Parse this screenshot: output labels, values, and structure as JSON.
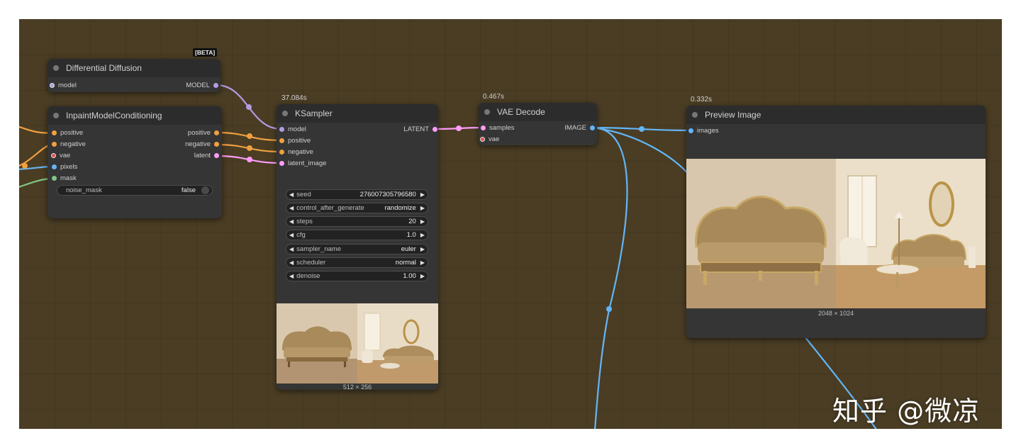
{
  "nodes": {
    "differential_diffusion": {
      "title": "Differential Diffusion",
      "badge": "[BETA]",
      "inputs": [
        "model"
      ],
      "outputs": [
        "MODEL"
      ]
    },
    "inpaint_model_conditioning": {
      "title": "InpaintModelConditioning",
      "inputs": [
        "positive",
        "negative",
        "vae",
        "pixels",
        "mask"
      ],
      "outputs": [
        "positive",
        "negative",
        "latent"
      ],
      "widget": {
        "label": "noise_mask",
        "value": "false"
      }
    },
    "ksampler": {
      "title": "KSampler",
      "exec_time": "37.084s",
      "inputs": [
        "model",
        "positive",
        "negative",
        "latent_image"
      ],
      "outputs": [
        "LATENT"
      ],
      "widgets": [
        {
          "label": "seed",
          "value": "276007305796580"
        },
        {
          "label": "control_after_generate",
          "value": "randomize"
        },
        {
          "label": "steps",
          "value": "20"
        },
        {
          "label": "cfg",
          "value": "1.0"
        },
        {
          "label": "sampler_name",
          "value": "euler"
        },
        {
          "label": "scheduler",
          "value": "normal"
        },
        {
          "label": "denoise",
          "value": "1.00"
        }
      ],
      "preview_size": "512 × 256"
    },
    "vae_decode": {
      "title": "VAE Decode",
      "exec_time": "0.467s",
      "inputs": [
        "samples",
        "vae"
      ],
      "outputs": [
        "IMAGE"
      ]
    },
    "preview_image": {
      "title": "Preview Image",
      "exec_time": "0.332s",
      "inputs": [
        "images"
      ],
      "image_size": "2048 × 1024"
    }
  },
  "icons": {
    "widget_left": "◀",
    "widget_right": "▶"
  },
  "colors": {
    "canvas_bg": "#4a3d24",
    "node_bg": "#353535",
    "model_link": "#b49ce0",
    "conditioning_link": "#f0a040",
    "vae_link": "#e25050",
    "image_link": "#64b5f6",
    "mask_link": "#81c784",
    "latent_link": "#ff9cf9"
  },
  "watermark": "知乎 @微凉"
}
